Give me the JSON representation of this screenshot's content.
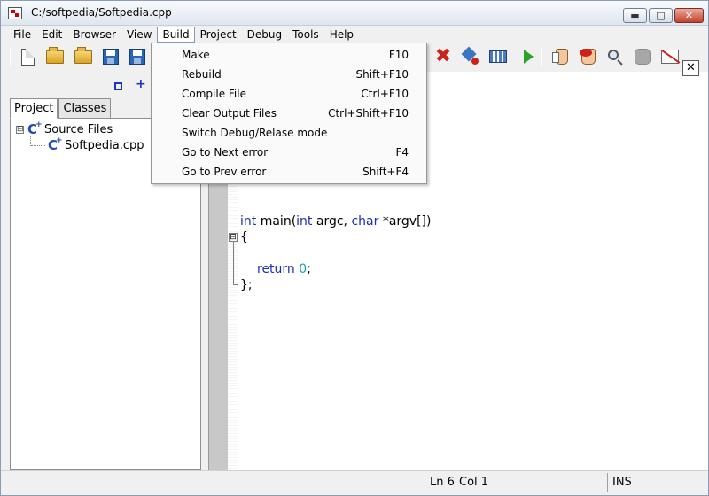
{
  "window": {
    "title": "C:/softpedia/Softpedia.cpp"
  },
  "menubar": {
    "items": [
      "File",
      "Edit",
      "Browser",
      "View",
      "Build",
      "Project",
      "Debug",
      "Tools",
      "Help"
    ],
    "active": "Build"
  },
  "build_menu": {
    "items": [
      {
        "label": "Make",
        "shortcut": "F10"
      },
      {
        "label": "Rebuild",
        "shortcut": "Shift+F10"
      },
      {
        "label": "Compile File",
        "shortcut": "Ctrl+F10"
      },
      {
        "label": "Clear Output Files",
        "shortcut": "Ctrl+Shift+F10"
      },
      {
        "label": "Switch Debug/Relase mode",
        "shortcut": ""
      },
      {
        "label": "Go to Next error",
        "shortcut": "F4"
      },
      {
        "label": "Go to Prev error",
        "shortcut": "Shift+F4"
      }
    ]
  },
  "toolbar": {
    "buttons": [
      "new-file-icon",
      "open-project-icon",
      "open-file-icon",
      "save-icon",
      "save-all-icon",
      "stop-build-icon",
      "build-options-icon",
      "build-grid-icon",
      "run-icon",
      "toggle-breakpoint-icon",
      "clear-breakpoints-icon",
      "find-icon",
      "stop-debug-icon",
      "hide-output-icon"
    ]
  },
  "sidebar": {
    "tabs": [
      "Project",
      "Classes"
    ],
    "active_tab": "Project",
    "tree": [
      {
        "label": "Source Files",
        "expander": "⊟"
      },
      {
        "label": "Softpedia.cpp"
      }
    ]
  },
  "editor": {
    "code": {
      "line1": {
        "kw1": "int",
        "t1": " main(",
        "kw2": "int",
        "t2": " argc, ",
        "kw3": "char",
        "t3": " *argv[])"
      },
      "line2": "{",
      "line3": {
        "kw": "return",
        "sp": " ",
        "num": "0",
        "end": ";"
      },
      "line4": "};"
    },
    "fold_symbol": "⊟"
  },
  "statusbar": {
    "ln": "Ln 6",
    "col": "Col 1",
    "mode": "INS"
  }
}
